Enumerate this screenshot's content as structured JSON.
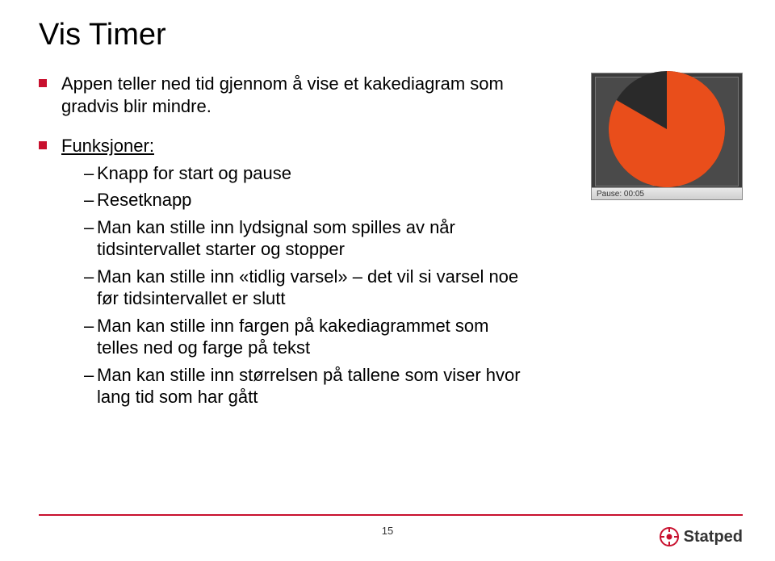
{
  "title": "Vis Timer",
  "bullets": [
    {
      "text": "Appen teller ned tid gjennom å vise et kakediagram som gradvis blir mindre."
    },
    {
      "text": "Funksjoner:",
      "underline": true,
      "sub": [
        "Knapp for start og pause",
        "Resetknapp",
        "Man kan stille inn lydsignal som spilles av når tidsintervallet starter og stopper",
        "Man kan stille inn «tidlig varsel» – det vil si varsel noe før tidsintervallet er slutt",
        "Man kan stille inn fargen på kakediagrammet som telles ned og farge på tekst",
        "Man kan stille inn størrelsen på tallene som viser hvor lang tid som har gått"
      ]
    }
  ],
  "widget": {
    "status_label": "Pause:",
    "status_time": "00:05",
    "pie_color": "#e94e1b",
    "pie_bg": "#2a2a2a",
    "remaining_deg": 300
  },
  "page_number": "15",
  "brand": "Statped",
  "colors": {
    "accent": "#c8102e"
  }
}
